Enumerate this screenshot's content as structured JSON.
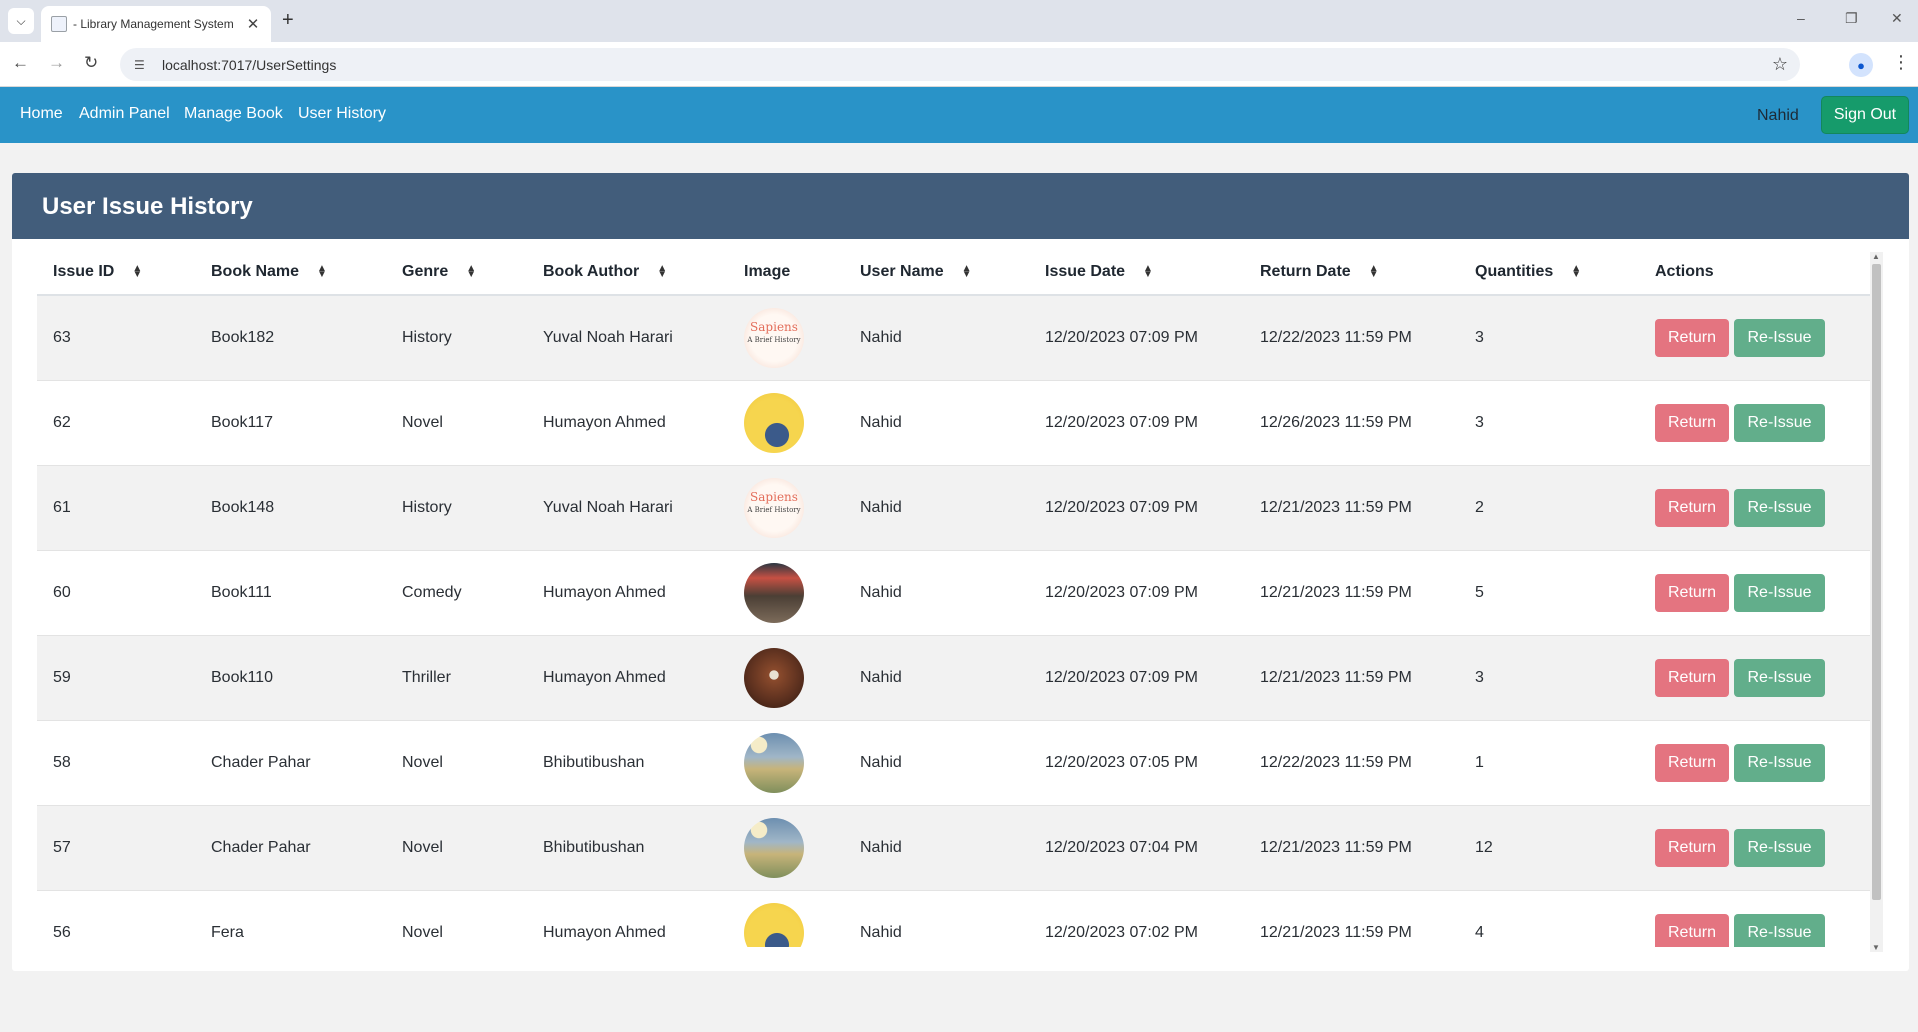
{
  "browser": {
    "tab_title": "- Library Management System",
    "url": "localhost:7017/UserSettings"
  },
  "nav": {
    "links": [
      "Home",
      "Admin Panel",
      "Manage Book",
      "User History"
    ],
    "user": "Nahid",
    "signout_label": "Sign Out"
  },
  "page": {
    "title": "User Issue History"
  },
  "table": {
    "headers": [
      "Issue ID",
      "Book Name",
      "Genre",
      "Book Author",
      "Image",
      "User Name",
      "Issue Date",
      "Return Date",
      "Quantities",
      "Actions"
    ],
    "return_label": "Return",
    "reissue_label": "Re-Issue",
    "rows": [
      {
        "id": "63",
        "book": "Book182",
        "genre": "History",
        "author": "Yuval Noah Harari",
        "image": "sapiens-cover",
        "user": "Nahid",
        "issue": "12/20/2023 07:09 PM",
        "return": "12/22/2023 11:59 PM",
        "qty": "3"
      },
      {
        "id": "62",
        "book": "Book117",
        "genre": "Novel",
        "author": "Humayon Ahmed",
        "image": "fera-cover",
        "user": "Nahid",
        "issue": "12/20/2023 07:09 PM",
        "return": "12/26/2023 11:59 PM",
        "qty": "3"
      },
      {
        "id": "61",
        "book": "Book148",
        "genre": "History",
        "author": "Yuval Noah Harari",
        "image": "sapiens-cover",
        "user": "Nahid",
        "issue": "12/20/2023 07:09 PM",
        "return": "12/21/2023 11:59 PM",
        "qty": "2"
      },
      {
        "id": "60",
        "book": "Book111",
        "genre": "Comedy",
        "author": "Humayon Ahmed",
        "image": "comedy-cover",
        "user": "Nahid",
        "issue": "12/20/2023 07:09 PM",
        "return": "12/21/2023 11:59 PM",
        "qty": "5"
      },
      {
        "id": "59",
        "book": "Book110",
        "genre": "Thriller",
        "author": "Humayon Ahmed",
        "image": "thriller-cover",
        "user": "Nahid",
        "issue": "12/20/2023 07:09 PM",
        "return": "12/21/2023 11:59 PM",
        "qty": "3"
      },
      {
        "id": "58",
        "book": "Chader Pahar",
        "genre": "Novel",
        "author": "Bhibutibushan",
        "image": "chader-pahar-cover",
        "user": "Nahid",
        "issue": "12/20/2023 07:05 PM",
        "return": "12/22/2023 11:59 PM",
        "qty": "1"
      },
      {
        "id": "57",
        "book": "Chader Pahar",
        "genre": "Novel",
        "author": "Bhibutibushan",
        "image": "chader-pahar-cover",
        "user": "Nahid",
        "issue": "12/20/2023 07:04 PM",
        "return": "12/21/2023 11:59 PM",
        "qty": "12"
      },
      {
        "id": "56",
        "book": "Fera",
        "genre": "Novel",
        "author": "Humayon Ahmed",
        "image": "fera-cover",
        "user": "Nahid",
        "issue": "12/20/2023 07:02 PM",
        "return": "12/21/2023 11:59 PM",
        "qty": "4"
      }
    ]
  },
  "colors": {
    "navbar": "#2993c8",
    "card_header": "#425d7b",
    "signout": "#169b6b",
    "return_button": "#e47480",
    "reissue_button": "#62ae8b"
  }
}
